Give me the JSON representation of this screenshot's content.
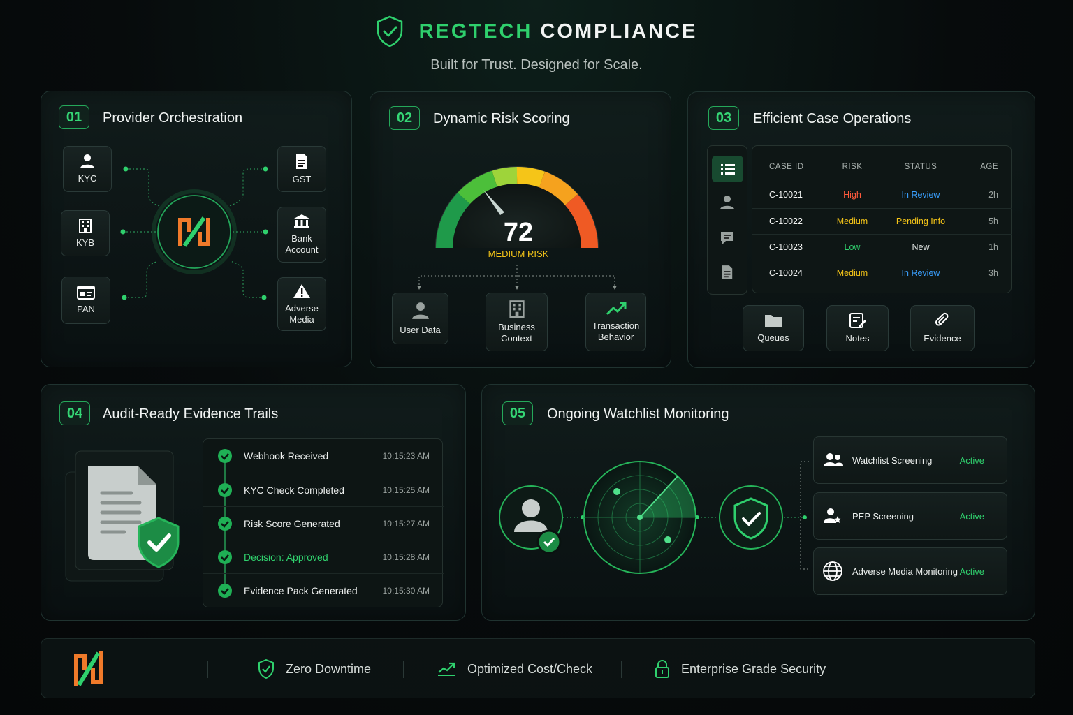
{
  "header": {
    "brand_green": "REGTECH",
    "brand_white": "COMPLIANCE",
    "tagline": "Built for Trust. Designed for Scale."
  },
  "colors": {
    "accent": "#2fd06d",
    "orange": "#f07a2a",
    "high": "#ff5a3c",
    "medium": "#f5c518",
    "review": "#3aa0ff"
  },
  "panel1": {
    "num": "01",
    "title": "Provider Orchestration",
    "left_tiles": [
      {
        "label": "KYC",
        "icon": "user-icon"
      },
      {
        "label": "KYB",
        "icon": "building-icon"
      },
      {
        "label": "PAN",
        "icon": "id-card-icon"
      }
    ],
    "right_tiles": [
      {
        "label": "GST",
        "icon": "document-icon"
      },
      {
        "label": "Bank Account",
        "icon": "bank-icon"
      },
      {
        "label": "Adverse Media",
        "icon": "warning-icon"
      }
    ]
  },
  "panel2": {
    "num": "02",
    "title": "Dynamic Risk Scoring",
    "score": "72",
    "risk_label": "MEDIUM RISK",
    "inputs": [
      {
        "label": "User Data",
        "icon": "user-icon"
      },
      {
        "label": "Business Context",
        "icon": "building-icon"
      },
      {
        "label": "Transaction Behavior",
        "icon": "trend-up-icon"
      }
    ]
  },
  "panel3": {
    "num": "03",
    "title": "Efficient Case Operations",
    "columns": [
      "CASE ID",
      "RISK",
      "STATUS",
      "AGE"
    ],
    "rows": [
      {
        "id": "C-10021",
        "risk": "High",
        "status": "In Review",
        "age": "2h"
      },
      {
        "id": "C-10022",
        "risk": "Medium",
        "status": "Pending Info",
        "age": "5h"
      },
      {
        "id": "C-10023",
        "risk": "Low",
        "status": "New",
        "age": "1h"
      },
      {
        "id": "C-10024",
        "risk": "Medium",
        "status": "In Review",
        "age": "3h"
      }
    ],
    "actions": [
      {
        "label": "Queues",
        "icon": "folder-icon"
      },
      {
        "label": "Notes",
        "icon": "notes-icon"
      },
      {
        "label": "Evidence",
        "icon": "paperclip-icon"
      }
    ]
  },
  "panel4": {
    "num": "04",
    "title": "Audit-Ready Evidence Trails",
    "events": [
      {
        "label": "Webhook Received",
        "time": "10:15:23 AM"
      },
      {
        "label": "KYC Check Completed",
        "time": "10:15:25 AM"
      },
      {
        "label": "Risk Score Generated",
        "time": "10:15:27 AM"
      },
      {
        "label": "Decision: Approved",
        "time": "10:15:28 AM"
      },
      {
        "label": "Evidence Pack Generated",
        "time": "10:15:30 AM"
      }
    ]
  },
  "panel5": {
    "num": "05",
    "title": "Ongoing Watchlist Monitoring",
    "monitors": [
      {
        "label": "Watchlist Screening",
        "status": "Active",
        "icon": "users-icon"
      },
      {
        "label": "PEP Screening",
        "status": "Active",
        "icon": "user-star-icon"
      },
      {
        "label": "Adverse Media Monitoring",
        "status": "Active",
        "icon": "globe-icon"
      }
    ]
  },
  "footer": {
    "items": [
      {
        "label": "Zero Downtime",
        "icon": "shield-check-icon"
      },
      {
        "label": "Optimized Cost/Check",
        "icon": "chart-up-icon"
      },
      {
        "label": "Enterprise Grade Security",
        "icon": "lock-icon"
      }
    ]
  }
}
